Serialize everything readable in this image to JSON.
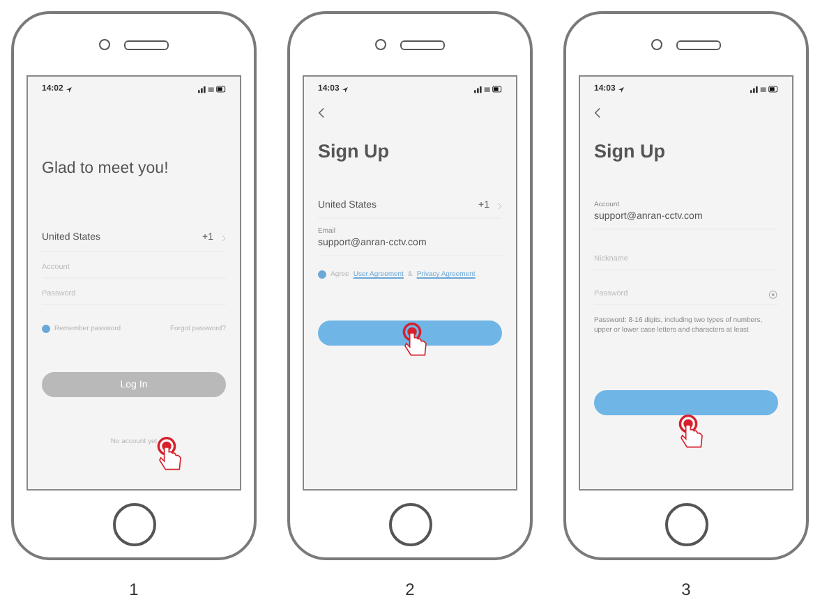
{
  "phones": [
    {
      "step": "1",
      "time": "14:02",
      "screen": {
        "kind": "login",
        "greeting": "Glad to meet you!",
        "country": "United States",
        "code": "+1",
        "account_placeholder": "Account",
        "password_placeholder": "Password",
        "remember": "Remember password",
        "remember_checked": true,
        "forgot": "Forgot password?",
        "button": "Log In",
        "footer": "No account yet"
      }
    },
    {
      "step": "2",
      "time": "14:03",
      "screen": {
        "kind": "signup_email",
        "title": "Sign Up",
        "country": "United States",
        "code": "+1",
        "email_label": "Email",
        "email": "support@anran-cctv.com",
        "agree_checked": true,
        "agree": "Agree",
        "user_agreement": "User Agreement",
        "and": "&",
        "privacy_agreement": "Privacy Agreement"
      }
    },
    {
      "step": "3",
      "time": "14:03",
      "screen": {
        "kind": "signup_details",
        "title": "Sign Up",
        "account_label": "Account",
        "account": "support@anran-cctv.com",
        "nickname_placeholder": "Nickname",
        "password_placeholder": "Password",
        "hint": "Password: 8-16 digits, including two types of numbers, upper or lower case letters and characters at least"
      }
    }
  ]
}
